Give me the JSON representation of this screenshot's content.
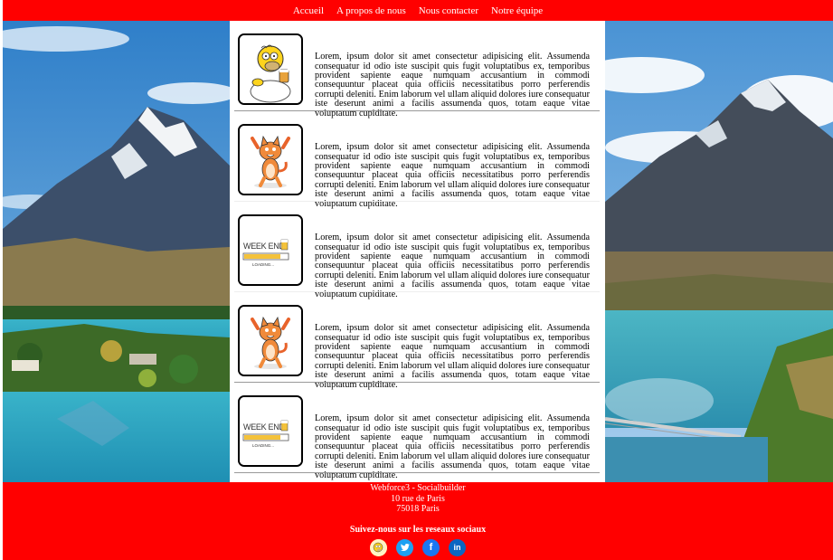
{
  "nav": {
    "items": [
      "Accueil",
      "A propos de nous",
      "Nous contacter",
      "Notre équipe"
    ]
  },
  "articles": [
    {
      "image": "homer-simpson-beer",
      "text": "Lorem, ipsum dolor sit amet consectetur adipisicing elit. Assumenda consequatur id odio iste suscipit quis fugit voluptatibus ex, temporibus provident sapiente eaque numquam accusantium in commodi consequuntur placeat quia officiis necessitatibus porro perferendis corrupti deleniti. Enim laborum vel ullam aliquid dolores iure consequatur iste deserunt animi a facilis assumenda quos, totam eaque vitae voluptatum cupiditate."
    },
    {
      "image": "dancing-cat",
      "text": "Lorem, ipsum dolor sit amet consectetur adipisicing elit. Assumenda consequatur id odio iste suscipit quis fugit voluptatibus ex, temporibus provident sapiente eaque numquam accusantium in commodi consequuntur placeat quia officiis necessitatibus porro perferendis corrupti deleniti. Enim laborum vel ullam aliquid dolores iure consequatur iste deserunt animi a facilis assumenda quos, totam eaque vitae voluptatum cupiditate."
    },
    {
      "image": "week-end-loading",
      "image_text": "WEEK END",
      "image_subtext": "LOADING...",
      "text": "Lorem, ipsum dolor sit amet consectetur adipisicing elit. Assumenda consequatur id odio iste suscipit quis fugit voluptatibus ex, temporibus provident sapiente eaque numquam accusantium in commodi consequuntur placeat quia officiis necessitatibus porro perferendis corrupti deleniti. Enim laborum vel ullam aliquid dolores iure consequatur iste deserunt animi a facilis assumenda quos, totam eaque vitae voluptatum cupiditate."
    },
    {
      "image": "dancing-cat",
      "text": "Lorem, ipsum dolor sit amet consectetur adipisicing elit. Assumenda consequatur id odio iste suscipit quis fugit voluptatibus ex, temporibus provident sapiente eaque numquam accusantium in commodi consequuntur placeat quia officiis necessitatibus porro perferendis corrupti deleniti. Enim laborum vel ullam aliquid dolores iure consequatur iste deserunt animi a facilis assumenda quos, totam eaque vitae voluptatum cupiditate."
    },
    {
      "image": "week-end-loading",
      "image_text": "WEEK END",
      "image_subtext": "LOADING...",
      "text": "Lorem, ipsum dolor sit amet consectetur adipisicing elit. Assumenda consequatur id odio iste suscipit quis fugit voluptatibus ex, temporibus provident sapiente eaque numquam accusantium in commodi consequuntur placeat quia officiis necessitatibus porro perferendis corrupti deleniti. Enim laborum vel ullam aliquid dolores iure consequatur iste deserunt animi a facilis assumenda quos, totam eaque vitae voluptatum cupiditate."
    }
  ],
  "footer": {
    "line1": "Webforce3 - Socialbuilder",
    "line2": "10 rue de Paris",
    "line3": "75018 Paris",
    "follow": "Suivez-nous sur les reseaux sociaux",
    "socials": [
      {
        "icon": "homer-icon",
        "color": "#f7c300"
      },
      {
        "icon": "twitter-icon",
        "color": "#1da1f2"
      },
      {
        "icon": "facebook-icon",
        "color": "#1877f2",
        "glyph": "f"
      },
      {
        "icon": "linkedin-icon",
        "color": "#0a66c2",
        "glyph": "in"
      }
    ]
  },
  "colors": {
    "brand": "#ff0000",
    "text": "#000000",
    "footer_text": "#ffffff"
  }
}
